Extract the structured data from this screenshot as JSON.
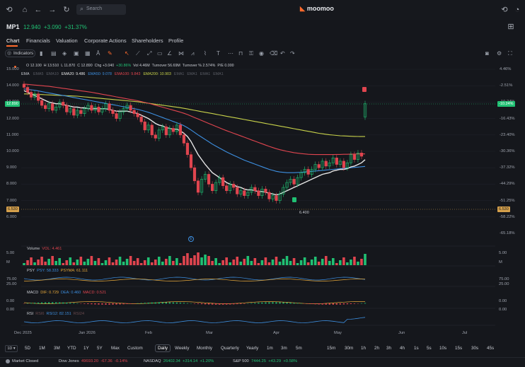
{
  "topbar": {
    "search_placeholder": "Search",
    "logo": "moomoo"
  },
  "quote": {
    "symbol": "MP1",
    "price": "12.940",
    "change": "+3.090",
    "change_pct": "+31.37%"
  },
  "tabs": [
    "Chart",
    "Financials",
    "Valuation",
    "Corporate Actions",
    "Shareholders",
    "Profile"
  ],
  "toolbar": {
    "indicators_label": "Indicators"
  },
  "ohlc": {
    "o": "O 12.100",
    "h": "H 13.510",
    "l": "L 11.870",
    "c": "C 12.890",
    "chg": "Chg +3.040",
    "pct": "+30.86%",
    "vol": "Vol 4.46M",
    "turnover": "Turnover 56.69M",
    "turnover_pct": "Turnover % 2.574%",
    "pe": "P/E 0.000"
  },
  "ema": {
    "label": "EMA",
    "items": [
      {
        "text": "EMA5",
        "color": "#5b5e66"
      },
      {
        "text": "EMA10",
        "color": "#5b5e66"
      },
      {
        "text": "EMA20: 9.486",
        "color": "#e6e6e6"
      },
      {
        "text": "EMA50: 9.078",
        "color": "#3d8fe0"
      },
      {
        "text": "EMA100: 9.843",
        "color": "#e0454f"
      },
      {
        "text": "EMA200: 10.903",
        "color": "#c8d24a"
      },
      {
        "text": "EMA1",
        "color": "#5b5e66"
      },
      {
        "text": "EMA1",
        "color": "#5b5e66"
      },
      {
        "text": "EMA1",
        "color": "#5b5e66"
      },
      {
        "text": "EMA1",
        "color": "#5b5e66"
      }
    ]
  },
  "y_left": [
    "15.000",
    "14.000",
    "13.000",
    "12.000",
    "11.000",
    "10.000",
    "9.000",
    "8.000",
    "7.000",
    "6.000"
  ],
  "y_right": [
    "4.46%",
    "-2.51%",
    "-10.24%",
    "-16.43%",
    "-23.40%",
    "-30.36%",
    "-37.32%",
    "-44.29%",
    "-51.25%",
    "-58.22%",
    "-65.18%"
  ],
  "price_box_left": "12.890",
  "price_box_right": "-10.24%",
  "low_box": "6.530",
  "low_label": "6.400",
  "volume": {
    "label": "Volume",
    "vol": "VOL: 4.461",
    "top": "5.00",
    "bottom": "M"
  },
  "psy": {
    "label": "PSY",
    "psy": "PSY: 58.333",
    "psyma": "PSYMA: 61.111",
    "top": "75.00",
    "bottom": "25.00"
  },
  "macd": {
    "label": "MACD",
    "dif": "DIF: 0.729",
    "dea": "DEA: 0.460",
    "macd": "MACD: 0.521",
    "top": "0.00",
    "bottom": "0.00"
  },
  "rsi": {
    "label": "RSI",
    "rsi6": "RSI6",
    "rsi12": "RSI12: 82.151",
    "rsi24": "RSI24"
  },
  "x_axis": [
    "Dec 2025",
    "Jan 2026",
    "Feb",
    "Mar",
    "Apr",
    "May",
    "Jun",
    "Jul"
  ],
  "timeframes": [
    "5D",
    "1M",
    "3M",
    "YTD",
    "1Y",
    "5Y",
    "Max",
    "Custom",
    "Daily",
    "Weekly",
    "Monthly",
    "Quarterly",
    "Yearly",
    "1m",
    "3m",
    "5m",
    "15m",
    "30m",
    "1h",
    "2h",
    "3h",
    "4h",
    "1s",
    "5s",
    "10s",
    "15s",
    "30s",
    "45s"
  ],
  "status": {
    "market": "Market Closed",
    "dow": {
      "name": "Dow Jones",
      "value": "49693.20",
      "chg": "-67.36",
      "pct": "-0.14%"
    },
    "nasdaq": {
      "name": "NASDAQ",
      "value": "26402.34",
      "chg": "+314.14",
      "pct": "+1.20%"
    },
    "sp": {
      "name": "S&P 500",
      "value": "7444.25",
      "chg": "+43.29",
      "pct": "+0.58%"
    }
  },
  "chart_data": {
    "type": "candlestick",
    "x_range": [
      "Dec 2025",
      "Jul 2026"
    ],
    "ylim": [
      5.5,
      15.0
    ],
    "closes": [
      13.9,
      13.6,
      13.3,
      13.5,
      13.1,
      12.8,
      12.6,
      12.9,
      12.5,
      12.7,
      13.0,
      12.8,
      12.4,
      12.6,
      12.2,
      12.5,
      12.3,
      12.6,
      12.8,
      12.5,
      12.7,
      12.4,
      12.6,
      12.9,
      12.5,
      12.3,
      12.0,
      12.4,
      12.6,
      12.8,
      12.5,
      12.3,
      12.1,
      11.8,
      11.3,
      11.6,
      11.0,
      10.8,
      11.3,
      11.5,
      11.0,
      11.4,
      11.2,
      11.6,
      11.0,
      10.5,
      9.8,
      9.0,
      8.2,
      7.5,
      8.3,
      8.6,
      8.0,
      7.6,
      8.1,
      8.4,
      7.9,
      7.6,
      8.0,
      7.8,
      7.4,
      7.6,
      7.3,
      7.5,
      7.8,
      7.6,
      7.3,
      7.7,
      7.5,
      7.1,
      7.3,
      7.0,
      7.4,
      7.8,
      8.1,
      8.3,
      8.0,
      8.4,
      8.7,
      8.9,
      8.6,
      8.9,
      9.2,
      9.0,
      9.4,
      9.1,
      9.3,
      9.6,
      9.2,
      9.4,
      9.0,
      9.3,
      9.8,
      9.5,
      9.9,
      9.7,
      12.9
    ],
    "ema20": [
      13.7,
      13.6,
      13.5,
      13.4,
      13.3,
      13.2,
      13.1,
      13.0,
      12.95,
      12.9,
      12.9,
      12.85,
      12.8,
      12.75,
      12.7,
      12.7,
      12.65,
      12.65,
      12.6,
      12.6,
      12.6,
      12.6,
      12.6,
      12.6,
      12.55,
      12.5,
      12.45,
      12.45,
      12.45,
      12.45,
      12.4,
      12.35,
      12.3,
      12.2,
      12.1,
      12.0,
      11.85,
      11.7,
      11.6,
      11.55,
      11.45,
      11.4,
      11.35,
      11.35,
      11.25,
      11.1,
      10.9,
      10.6,
      10.2,
      9.8,
      9.5,
      9.2,
      8.95,
      8.7,
      8.55,
      8.4,
      8.25,
      8.1,
      8.0,
      7.95,
      7.85,
      7.8,
      7.7,
      7.65,
      7.65,
      7.6,
      7.55,
      7.55,
      7.5,
      7.45,
      7.4,
      7.35,
      7.4,
      7.5,
      7.6,
      7.7,
      7.8,
      7.9,
      8.0,
      8.1,
      8.2,
      8.3,
      8.4,
      8.5,
      8.6,
      8.65,
      8.7,
      8.8,
      8.85,
      8.9,
      8.9,
      8.95,
      9.05,
      9.1,
      9.2,
      9.3,
      9.49
    ],
    "ema50": [
      13.8,
      13.78,
      13.75,
      13.72,
      13.68,
      13.64,
      13.6,
      13.56,
      13.52,
      13.48,
      13.44,
      13.4,
      13.36,
      13.32,
      13.28,
      13.24,
      13.2,
      13.16,
      13.12,
      13.08,
      13.04,
      13.0,
      12.96,
      12.92,
      12.88,
      12.84,
      12.8,
      12.76,
      12.72,
      12.68,
      12.64,
      12.6,
      12.56,
      12.5,
      12.44,
      12.38,
      12.3,
      12.22,
      12.14,
      12.06,
      11.98,
      11.9,
      11.82,
      11.74,
      11.66,
      11.56,
      11.44,
      11.3,
      11.15,
      11.0,
      10.86,
      10.72,
      10.58,
      10.44,
      10.32,
      10.2,
      10.08,
      9.96,
      9.86,
      9.76,
      9.66,
      9.56,
      9.46,
      9.38,
      9.3,
      9.22,
      9.14,
      9.06,
      8.98,
      8.9,
      8.84,
      8.78,
      8.74,
      8.72,
      8.7,
      8.7,
      8.7,
      8.71,
      8.72,
      8.74,
      8.76,
      8.78,
      8.8,
      8.82,
      8.84,
      8.86,
      8.88,
      8.9,
      8.92,
      8.94,
      8.96,
      8.98,
      9.0,
      9.02,
      9.04,
      9.06,
      9.08
    ],
    "ema100": [
      14.1,
      14.08,
      14.06,
      14.04,
      14.02,
      14.0,
      13.98,
      13.96,
      13.93,
      13.9,
      13.87,
      13.84,
      13.81,
      13.78,
      13.75,
      13.72,
      13.69,
      13.66,
      13.63,
      13.6,
      13.56,
      13.52,
      13.48,
      13.44,
      13.4,
      13.36,
      13.32,
      13.28,
      13.24,
      13.2,
      13.16,
      13.12,
      13.08,
      13.03,
      12.98,
      12.93,
      12.87,
      12.81,
      12.75,
      12.69,
      12.63,
      12.57,
      12.51,
      12.45,
      12.39,
      12.32,
      12.24,
      12.15,
      12.06,
      11.97,
      11.88,
      11.79,
      11.7,
      11.61,
      11.52,
      11.43,
      11.34,
      11.26,
      11.18,
      11.1,
      11.02,
      10.94,
      10.86,
      10.78,
      10.7,
      10.62,
      10.54,
      10.46,
      10.38,
      10.3,
      10.23,
      10.16,
      10.1,
      10.05,
      10.0,
      9.96,
      9.92,
      9.89,
      9.86,
      9.84,
      9.82,
      9.81,
      9.8,
      9.8,
      9.8,
      9.8,
      9.8,
      9.8,
      9.81,
      9.81,
      9.82,
      9.82,
      9.83,
      9.83,
      9.84,
      9.84,
      9.84
    ],
    "ema200": [
      13.5,
      13.5,
      13.49,
      13.48,
      13.47,
      13.46,
      13.45,
      13.44,
      13.43,
      13.42,
      13.41,
      13.4,
      13.39,
      13.38,
      13.37,
      13.36,
      13.34,
      13.32,
      13.3,
      13.28,
      13.26,
      13.24,
      13.22,
      13.2,
      13.18,
      13.16,
      13.14,
      13.12,
      13.1,
      13.08,
      13.06,
      13.04,
      13.02,
      12.99,
      12.96,
      12.93,
      12.9,
      12.87,
      12.84,
      12.81,
      12.78,
      12.75,
      12.72,
      12.69,
      12.66,
      12.62,
      12.58,
      12.54,
      12.5,
      12.46,
      12.42,
      12.38,
      12.34,
      12.3,
      12.26,
      12.22,
      12.18,
      12.14,
      12.1,
      12.06,
      12.02,
      11.98,
      11.94,
      11.9,
      11.86,
      11.82,
      11.78,
      11.74,
      11.7,
      11.66,
      11.62,
      11.58,
      11.54,
      11.5,
      11.46,
      11.42,
      11.38,
      11.34,
      11.3,
      11.26,
      11.22,
      11.18,
      11.14,
      11.1,
      11.07,
      11.04,
      11.01,
      10.99,
      10.97,
      10.95,
      10.94,
      10.93,
      10.92,
      10.91,
      10.905,
      10.903,
      10.903
    ]
  }
}
